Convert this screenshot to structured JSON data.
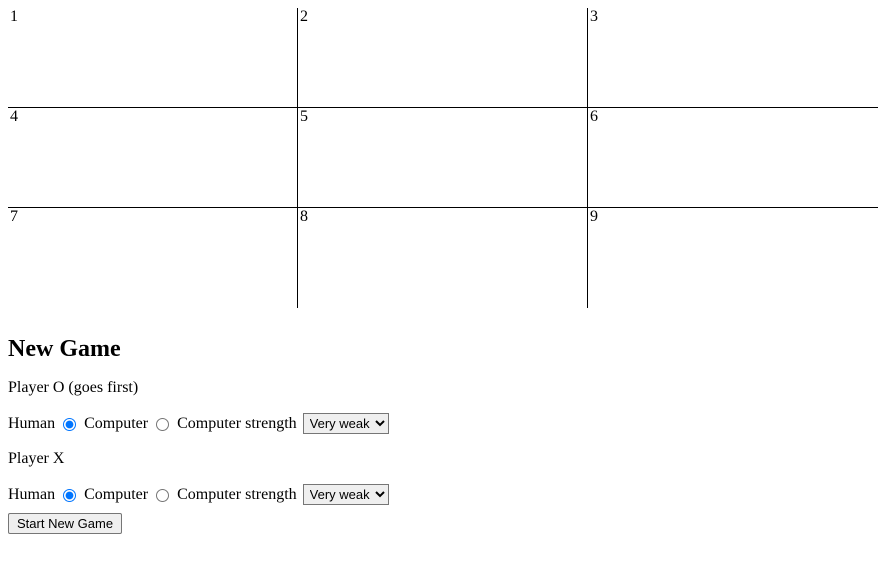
{
  "board": {
    "cells": [
      "1",
      "2",
      "3",
      "4",
      "5",
      "6",
      "7",
      "8",
      "9"
    ]
  },
  "heading": "New Game",
  "playerO": {
    "label": "Player O (goes first)",
    "human_label": "Human",
    "computer_label": "Computer",
    "strength_label": "Computer strength",
    "strength_selected": "Very weak",
    "human_checked": true,
    "computer_checked": false
  },
  "playerX": {
    "label": "Player X",
    "human_label": "Human",
    "computer_label": "Computer",
    "strength_label": "Computer strength",
    "strength_selected": "Very weak",
    "human_checked": true,
    "computer_checked": false
  },
  "start_button": "Start New Game"
}
